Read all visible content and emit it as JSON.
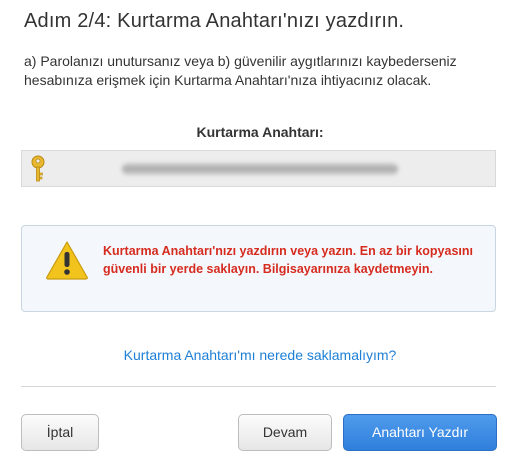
{
  "header": {
    "title": "Adım 2/4: Kurtarma Anahtarı'nızı yazdırın.",
    "description": "a) Parolanızı unutursanız veya b) güvenilir aygıtlarınızı kaybederseniz hesabınıza erişmek için Kurtarma Anahtarı'nıza ihtiyacınız olacak."
  },
  "recovery_key": {
    "label": "Kurtarma Anahtarı:",
    "icon": "key-icon",
    "icon_color": "#e8b830"
  },
  "warning": {
    "icon": "warning-triangle-icon",
    "icon_color": "#f2c31c",
    "text": "Kurtarma Anahtarı'nızı yazdırın veya yazın. En az bir kopyasını güvenli bir yerde saklayın. Bilgisayarınıza kaydetmeyin.",
    "text_color": "#d62b1f"
  },
  "help_link": {
    "label": "Kurtarma Anahtarı'mı nerede saklamalıyım?",
    "color": "#1e7fd6"
  },
  "buttons": {
    "cancel_label": "İptal",
    "continue_label": "Devam",
    "print_label": "Anahtarı Yazdır",
    "primary_color": "#3a8ae4"
  }
}
